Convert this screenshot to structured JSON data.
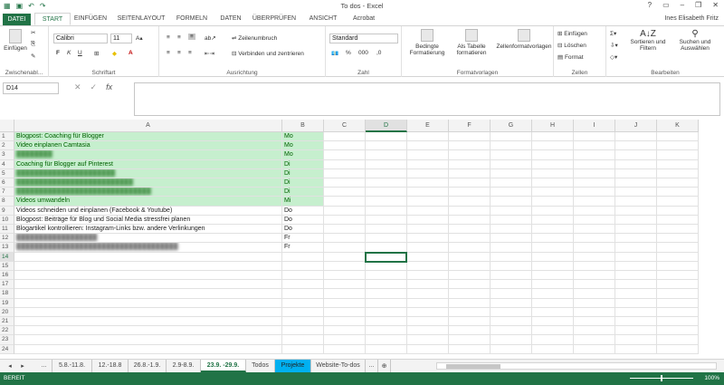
{
  "window": {
    "title": "To dos - Excel",
    "user": "Ines Elisabeth Fritz"
  },
  "ribbon_tabs": [
    "DATEI",
    "START",
    "EINFÜGEN",
    "SEITENLAYOUT",
    "FORMELN",
    "DATEN",
    "ÜBERPRÜFEN",
    "ANSICHT",
    "Acrobat"
  ],
  "ribbon": {
    "clipboard": {
      "paste": "Einfügen",
      "group": "Zwischenabl..."
    },
    "font": {
      "name": "Calibri",
      "size": "11",
      "bold": "F",
      "italic": "K",
      "underline": "U",
      "group": "Schriftart"
    },
    "alignment": {
      "wrap": "Zeilenumbruch",
      "merge": "Verbinden und zentrieren",
      "group": "Ausrichtung"
    },
    "number": {
      "format": "Standard",
      "group": "Zahl"
    },
    "styles": {
      "conditional": "Bedingte Formatierung",
      "table": "Als Tabelle formatieren",
      "cellstyles": "Zellenformatvorlagen",
      "group": "Formatvorlagen"
    },
    "cells": {
      "insert": "Einfügen",
      "delete": "Löschen",
      "format": "Format",
      "group": "Zellen"
    },
    "editing": {
      "sort": "Sortieren und Filtern",
      "find": "Suchen und Auswählen",
      "group": "Bearbeiten"
    }
  },
  "formula_bar": {
    "name_box": "D14",
    "fx": "fx",
    "content": ""
  },
  "columns": [
    "A",
    "B",
    "C",
    "D",
    "E",
    "F",
    "G",
    "H",
    "I",
    "J",
    "K"
  ],
  "selected_cell": "D14",
  "rows": [
    {
      "n": "1",
      "a": "Blogpost: Coaching für Blogger",
      "b": "Mo",
      "hl": true,
      "blur": false
    },
    {
      "n": "2",
      "a": "Video einplanen Camtasia",
      "b": "Mo",
      "hl": true,
      "blur": false
    },
    {
      "n": "3",
      "a": "████████",
      "b": "Mo",
      "hl": true,
      "blur": true
    },
    {
      "n": "4",
      "a": "Coaching für Blogger auf Pinterest",
      "b": "Di",
      "hl": true,
      "blur": false
    },
    {
      "n": "5",
      "a": "██████████████████████",
      "b": "Di",
      "hl": true,
      "blur": true
    },
    {
      "n": "6",
      "a": "██████████████████████████",
      "b": "Di",
      "hl": true,
      "blur": true
    },
    {
      "n": "7",
      "a": "██████████████████████████████",
      "b": "Di",
      "hl": true,
      "blur": true
    },
    {
      "n": "8",
      "a": "Videos umwandeln",
      "b": "Mi",
      "hl": true,
      "blur": false
    },
    {
      "n": "9",
      "a": "Videos schneiden und einplanen (Facebook & Youtube)",
      "b": "Do",
      "hl": false,
      "blur": false
    },
    {
      "n": "10",
      "a": "Blogpost: Beiträge für Blog und Social Media stressfrei planen",
      "b": "Do",
      "hl": false,
      "blur": false
    },
    {
      "n": "11",
      "a": "Blogartikel kontrollieren: Instagram-Links bzw. andere Verlinkungen",
      "b": "Do",
      "hl": false,
      "blur": false
    },
    {
      "n": "12",
      "a": "██████████████████",
      "b": "Fr",
      "hl": false,
      "blur": true
    },
    {
      "n": "13",
      "a": "████████████████████████████████████",
      "b": "Fr",
      "hl": false,
      "blur": true
    },
    {
      "n": "14",
      "a": "",
      "b": "",
      "hl": false,
      "blur": false
    },
    {
      "n": "15",
      "a": "",
      "b": "",
      "hl": false,
      "blur": false
    },
    {
      "n": "16",
      "a": "",
      "b": "",
      "hl": false,
      "blur": false
    },
    {
      "n": "17",
      "a": "",
      "b": "",
      "hl": false,
      "blur": false
    },
    {
      "n": "18",
      "a": "",
      "b": "",
      "hl": false,
      "blur": false
    },
    {
      "n": "19",
      "a": "",
      "b": "",
      "hl": false,
      "blur": false
    },
    {
      "n": "20",
      "a": "",
      "b": "",
      "hl": false,
      "blur": false
    },
    {
      "n": "21",
      "a": "",
      "b": "",
      "hl": false,
      "blur": false
    },
    {
      "n": "22",
      "a": "",
      "b": "",
      "hl": false,
      "blur": false
    },
    {
      "n": "23",
      "a": "",
      "b": "",
      "hl": false,
      "blur": false
    },
    {
      "n": "24",
      "a": "",
      "b": "",
      "hl": false,
      "blur": false
    }
  ],
  "sheet_tabs": [
    {
      "label": "...",
      "state": "normal"
    },
    {
      "label": "5.8.-11.8.",
      "state": "normal"
    },
    {
      "label": "12.-18.8",
      "state": "normal"
    },
    {
      "label": "26.8.-1.9.",
      "state": "normal"
    },
    {
      "label": "2.9-8.9.",
      "state": "normal"
    },
    {
      "label": "23.9. -29.9.",
      "state": "active"
    },
    {
      "label": "Todos",
      "state": "normal"
    },
    {
      "label": "Projekte",
      "state": "cyan"
    },
    {
      "label": "Website-To-dos",
      "state": "normal"
    },
    {
      "label": "...",
      "state": "normal"
    },
    {
      "label": "⊕",
      "state": "normal"
    }
  ],
  "status": {
    "mode": "BEREIT",
    "zoom": "100%"
  },
  "colors": {
    "accent": "#217346",
    "highlight_fill": "#c6efce",
    "highlight_text": "#006100",
    "cyan_tab": "#00b0f0"
  }
}
